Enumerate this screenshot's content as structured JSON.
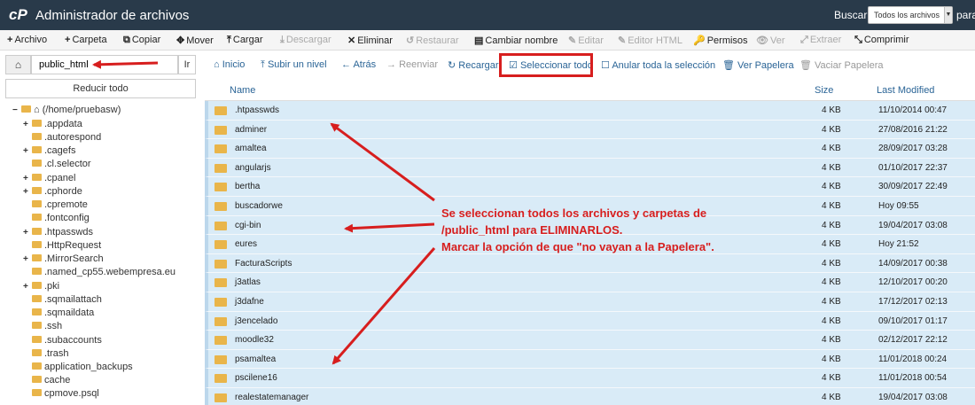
{
  "topbar": {
    "logo": "cP",
    "title": "Administrador de archivos",
    "search_label": "Buscar",
    "search_select": "Todos los archivos",
    "search_for": "para"
  },
  "toolbar": [
    {
      "icon": "+",
      "label": "Archivo",
      "disabled": false
    },
    {
      "icon": "+",
      "label": "Carpeta",
      "disabled": false
    },
    {
      "icon": "⧉",
      "label": "Copiar",
      "disabled": false
    },
    {
      "icon": "✥",
      "label": "Mover",
      "disabled": false
    },
    {
      "icon": "⤒",
      "label": "Cargar",
      "disabled": false
    },
    {
      "icon": "⤓",
      "label": "Descargar",
      "disabled": true
    },
    {
      "icon": "✕",
      "label": "Eliminar",
      "disabled": false
    },
    {
      "icon": "↺",
      "label": "Restaurar",
      "disabled": true
    },
    {
      "icon": "▤",
      "label": "Cambiar nombre",
      "disabled": false
    },
    {
      "icon": "✎",
      "label": "Editar",
      "disabled": true
    },
    {
      "icon": "✎",
      "label": "Editor HTML",
      "disabled": true
    },
    {
      "icon": "🔑",
      "label": "Permisos",
      "disabled": false
    },
    {
      "icon": "👁",
      "label": "Ver",
      "disabled": true
    },
    {
      "icon": "⤢",
      "label": "Extraer",
      "disabled": true
    },
    {
      "icon": "⤡",
      "label": "Comprimir",
      "disabled": false
    }
  ],
  "left": {
    "path_value": "public_html",
    "go_label": "Ir",
    "collapse_label": "Reducir todo",
    "tree_root": "(/home/pruebasw)",
    "tree": [
      {
        "label": ".appdata",
        "expandable": true
      },
      {
        "label": ".autorespond",
        "expandable": false
      },
      {
        "label": ".cagefs",
        "expandable": true
      },
      {
        "label": ".cl.selector",
        "expandable": false
      },
      {
        "label": ".cpanel",
        "expandable": true
      },
      {
        "label": ".cphorde",
        "expandable": true
      },
      {
        "label": ".cpremote",
        "expandable": false
      },
      {
        "label": ".fontconfig",
        "expandable": false
      },
      {
        "label": ".htpasswds",
        "expandable": true
      },
      {
        "label": ".HttpRequest",
        "expandable": false
      },
      {
        "label": ".MirrorSearch",
        "expandable": true
      },
      {
        "label": ".named_cp55.webempresa.eu",
        "expandable": false
      },
      {
        "label": ".pki",
        "expandable": true
      },
      {
        "label": ".sqmailattach",
        "expandable": false
      },
      {
        "label": ".sqmaildata",
        "expandable": false
      },
      {
        "label": ".ssh",
        "expandable": false
      },
      {
        "label": ".subaccounts",
        "expandable": false
      },
      {
        "label": ".trash",
        "expandable": false
      },
      {
        "label": "application_backups",
        "expandable": false
      },
      {
        "label": "cache",
        "expandable": false
      },
      {
        "label": "cpmove.psql",
        "expandable": false
      }
    ]
  },
  "navbar": [
    {
      "icon": "⌂",
      "label": "Inicio",
      "disabled": false
    },
    {
      "icon": "⤒",
      "label": "Subir un nivel",
      "disabled": false
    },
    {
      "icon": "←",
      "label": "Atrás",
      "disabled": false
    },
    {
      "icon": "→",
      "label": "Reenviar",
      "disabled": true
    },
    {
      "icon": "↻",
      "label": "Recargar",
      "disabled": false
    },
    {
      "icon": "☑",
      "label": "Seleccionar todo",
      "disabled": false
    },
    {
      "icon": "☐",
      "label": "Anular toda la selección",
      "disabled": false
    },
    {
      "icon": "🗑",
      "label": "Ver Papelera",
      "disabled": false
    },
    {
      "icon": "🗑",
      "label": "Vaciar Papelera",
      "disabled": true
    }
  ],
  "table": {
    "headers": {
      "name": "Name",
      "size": "Size",
      "modified": "Last Modified"
    },
    "rows": [
      {
        "name": ".htpasswds",
        "size": "4 KB",
        "modified": "11/10/2014 00:47"
      },
      {
        "name": "adminer",
        "size": "4 KB",
        "modified": "27/08/2016 21:22"
      },
      {
        "name": "amaltea",
        "size": "4 KB",
        "modified": "28/09/2017 03:28"
      },
      {
        "name": "angularjs",
        "size": "4 KB",
        "modified": "01/10/2017 22:37"
      },
      {
        "name": "bertha",
        "size": "4 KB",
        "modified": "30/09/2017 22:49"
      },
      {
        "name": "buscadorwe",
        "size": "4 KB",
        "modified": "Hoy 09:55"
      },
      {
        "name": "cgi-bin",
        "size": "4 KB",
        "modified": "19/04/2017 03:08"
      },
      {
        "name": "eures",
        "size": "4 KB",
        "modified": "Hoy 21:52"
      },
      {
        "name": "FacturaScripts",
        "size": "4 KB",
        "modified": "14/09/2017 00:38"
      },
      {
        "name": "j3atlas",
        "size": "4 KB",
        "modified": "12/10/2017 00:20"
      },
      {
        "name": "j3dafne",
        "size": "4 KB",
        "modified": "17/12/2017 02:13"
      },
      {
        "name": "j3encelado",
        "size": "4 KB",
        "modified": "09/10/2017 01:17"
      },
      {
        "name": "moodle32",
        "size": "4 KB",
        "modified": "02/12/2017 22:12"
      },
      {
        "name": "psamaltea",
        "size": "4 KB",
        "modified": "11/01/2018 00:24"
      },
      {
        "name": "pscilene16",
        "size": "4 KB",
        "modified": "11/01/2018 00:54"
      },
      {
        "name": "realestatemanager",
        "size": "4 KB",
        "modified": "19/04/2017 03:08"
      }
    ]
  },
  "annotation": {
    "line1": "Se seleccionan todos los archivos y carpetas de",
    "line2": "/public_html para ELIMINARLOS.",
    "line3": "Marcar la opción de que \"no vayan a la Papelera\".",
    "color": "#d71e1e"
  }
}
